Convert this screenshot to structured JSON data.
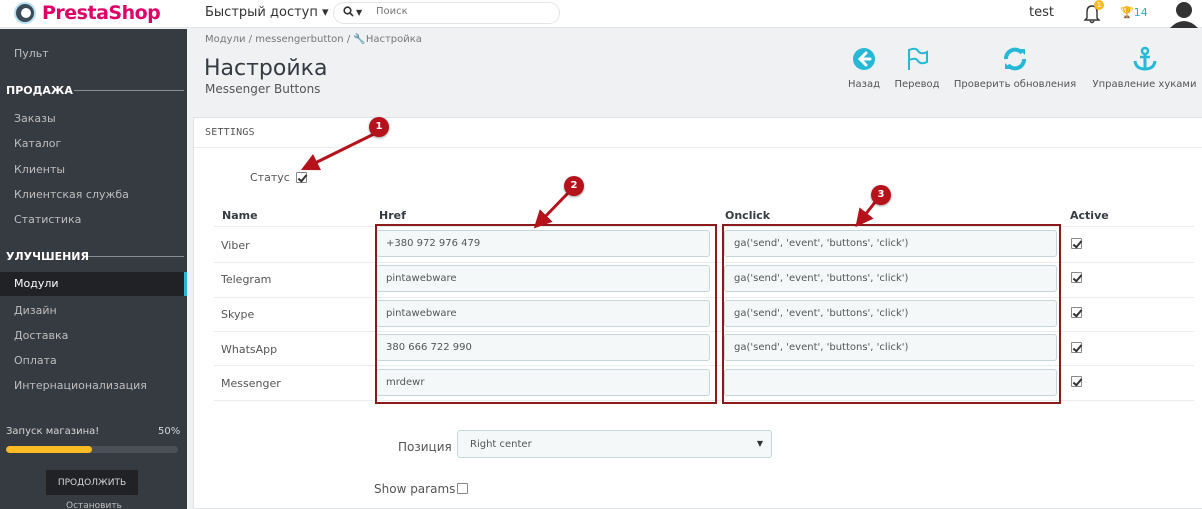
{
  "header": {
    "brand": "PrestaShop",
    "quick_access": "Быстрый доступ ▾",
    "search_placeholder": "Поиск",
    "user": "test",
    "notifications": "1",
    "trophy_count": "14"
  },
  "sidebar": {
    "dashboard": "Пульт",
    "section_sell": "ПРОДАЖА",
    "sell_items": [
      "Заказы",
      "Каталог",
      "Клиенты",
      "Клиентская служба",
      "Статистика"
    ],
    "section_improve": "УЛУЧШЕНИЯ",
    "active_item": "Модули",
    "improve_items": [
      "Дизайн",
      "Доставка",
      "Оплата",
      "Интернационализация"
    ],
    "launch_label": "Запуск магазина!",
    "launch_percent": "50%",
    "launch_progress": 0.5,
    "continue_label": "ПРОДОЛЖИТЬ",
    "stop_label": "Остановить"
  },
  "page": {
    "breadcrumb_1": "Модули",
    "breadcrumb_2": "messengerbutton",
    "breadcrumb_3": "Настройка",
    "title": "Настройка",
    "subtitle": "Messenger Buttons"
  },
  "toolbar": {
    "back": "Назад",
    "translate": "Перевод",
    "check_updates": "Проверить обновления",
    "manage_hooks": "Управление хуками"
  },
  "panel": {
    "title": "SETTINGS",
    "status_label": "Статус",
    "status_checked": true,
    "columns": {
      "name": "Name",
      "href": "Href",
      "onclick": "Onclick",
      "active": "Active"
    },
    "rows": [
      {
        "name": "Viber",
        "href": "+380 972 976 479",
        "onclick": "ga('send', 'event', 'buttons', 'click')",
        "active": true
      },
      {
        "name": "Telegram",
        "href": "pintawebware",
        "onclick": "ga('send', 'event', 'buttons', 'click')",
        "active": true
      },
      {
        "name": "Skype",
        "href": "pintawebware",
        "onclick": "ga('send', 'event', 'buttons', 'click')",
        "active": true
      },
      {
        "name": "WhatsApp",
        "href": "380 666 722 990",
        "onclick": "ga('send', 'event', 'buttons', 'click')",
        "active": true
      },
      {
        "name": "Messenger",
        "href": "mrdewr",
        "onclick": "",
        "active": true
      }
    ],
    "position_label": "Позиция",
    "position_value": "Right center",
    "show_params_label": "Show params",
    "show_params_checked": false
  },
  "annotations": [
    "1",
    "2",
    "3"
  ],
  "colors": {
    "brand": "#df0067",
    "sidebar": "#363a41",
    "accent": "#25b9d7",
    "progress": "#fbbb22",
    "annotation": "#b5121b"
  }
}
